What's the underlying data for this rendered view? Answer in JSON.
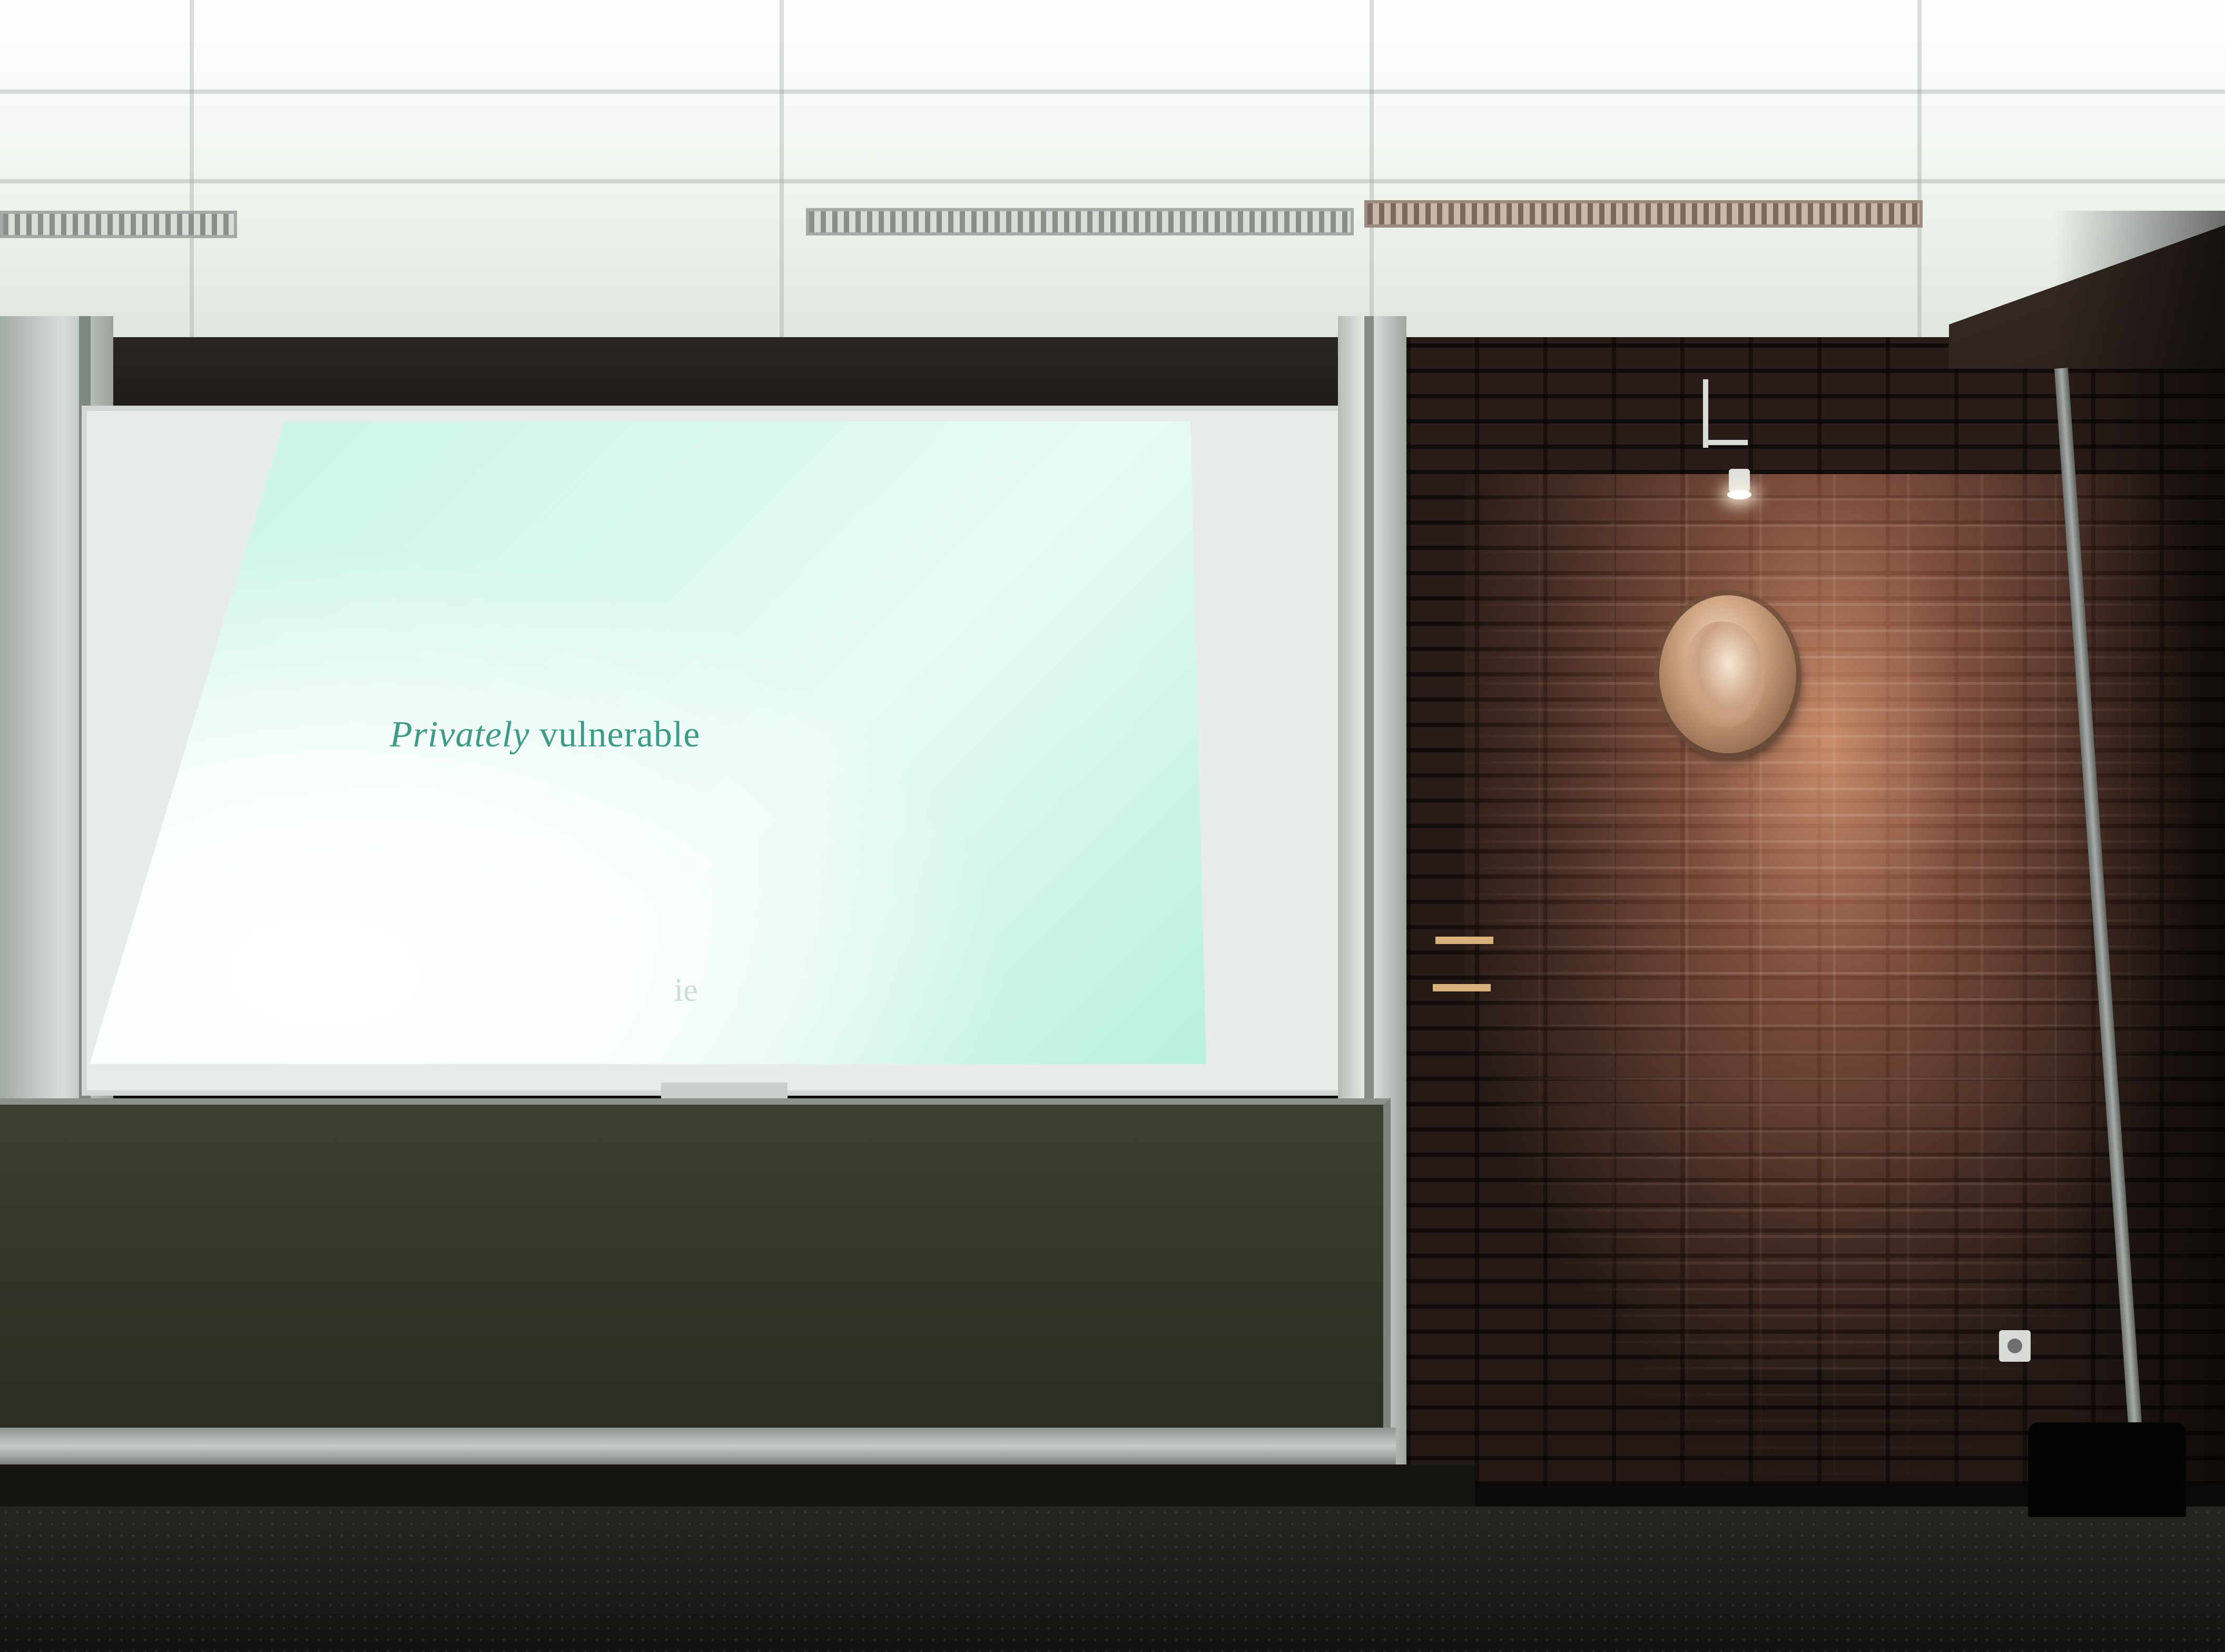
{
  "slide": {
    "title_italic": "Privately",
    "title_rest": " vulnerable",
    "footer_fragment": "ie"
  },
  "colors": {
    "slide_text": "#3f9a86",
    "screen_glow": "#c8f3e4",
    "brick": "#8a4d3a",
    "chalkboard": "#33362a"
  },
  "icons": {
    "spotlight": "spotlight-icon",
    "outlet": "power-outlet-icon",
    "medallion": "portrait-medallion"
  }
}
